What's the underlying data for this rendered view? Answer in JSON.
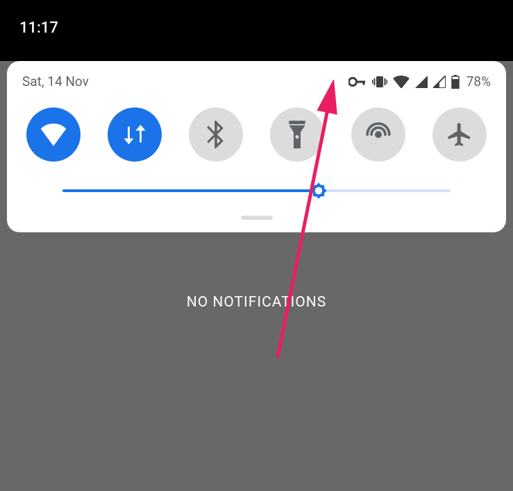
{
  "status_bar": {
    "time": "11:17"
  },
  "panel": {
    "date": "Sat, 14 Nov",
    "battery_percent": "78%",
    "brightness_percent": 66
  },
  "tiles": {
    "wifi": {
      "state": "on"
    },
    "data": {
      "state": "on"
    },
    "bluetooth": {
      "state": "off"
    },
    "flashlight": {
      "state": "off"
    },
    "hotspot": {
      "state": "off"
    },
    "airplane": {
      "state": "off"
    }
  },
  "notifications": {
    "empty_text": "NO NOTIFICATIONS"
  }
}
